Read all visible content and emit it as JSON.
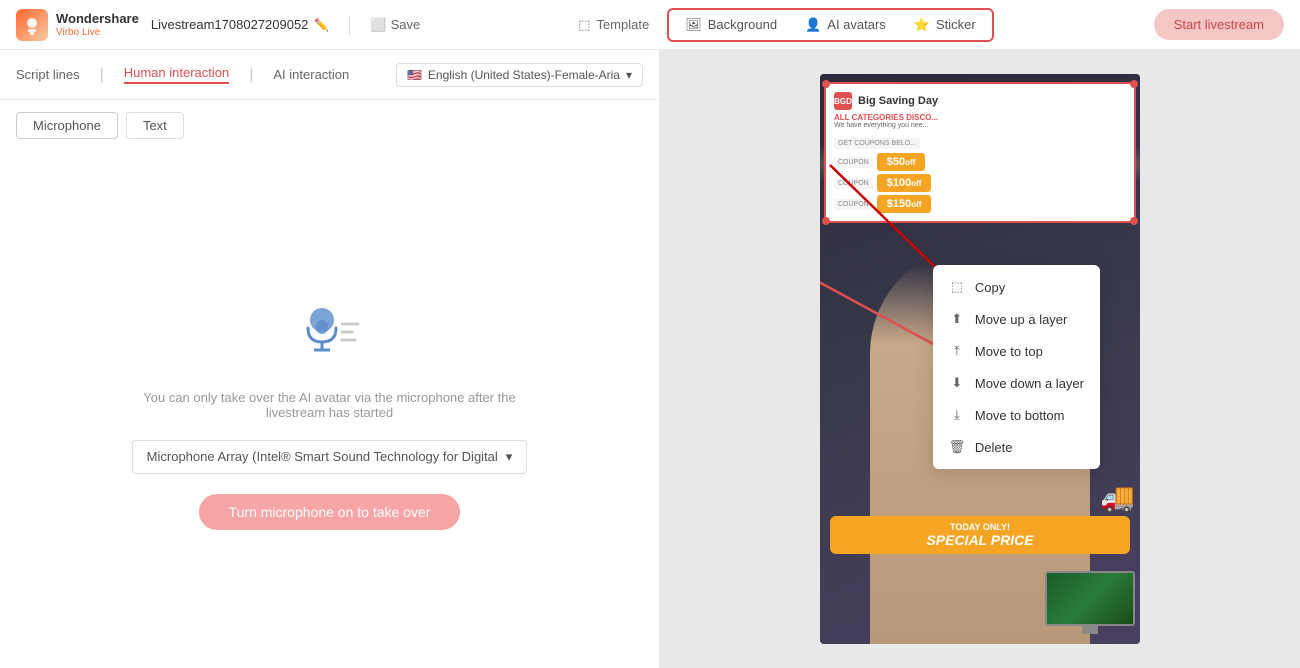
{
  "app": {
    "logo_line1": "Wondershare",
    "logo_line2": "Virbo Live",
    "stream_name": "Livestream1708027209052",
    "save_label": "Save",
    "template_label": "Template",
    "start_label": "Start livestream"
  },
  "header_tools": {
    "background_label": "Background",
    "ai_avatars_label": "AI avatars",
    "sticker_label": "Sticker"
  },
  "script": {
    "label": "Script lines",
    "tab_human": "Human interaction",
    "tab_ai": "AI interaction",
    "lang": "English (United States)-Female-Aria"
  },
  "sub_tabs": {
    "microphone_label": "Microphone",
    "text_label": "Text"
  },
  "mic_section": {
    "hint": "You can only take over the AI avatar via the microphone after the livestream has started",
    "device": "Microphone Array (Intel® Smart Sound Technology for Digital",
    "toggle_btn": "Turn microphone on to take over"
  },
  "context_menu": {
    "copy": "Copy",
    "move_up": "Move up a layer",
    "move_to_top": "Move to top",
    "move_down": "Move down a layer",
    "move_to_bottom": "Move to bottom",
    "delete": "Delete"
  },
  "sticker": {
    "logo_text": "BGD",
    "title": "Big Saving Day",
    "red_text": "ALL CATEGORIES DISCO...",
    "sub_text": "We have everything you nee...",
    "cta": "GET COUPONS BELO...",
    "coupons": [
      {
        "label": "COUPON",
        "amount": "$50",
        "suffix": "off"
      },
      {
        "label": "COUPON",
        "amount": "$100",
        "suffix": "off"
      },
      {
        "label": "COUPON",
        "amount": "$150",
        "suffix": "off"
      }
    ]
  },
  "special_price": {
    "today": "TODAY ONLY!",
    "text": "SPECIAL PRICE"
  },
  "colors": {
    "accent_red": "#e05050",
    "accent_orange": "#f5a523",
    "header_border": "#e8e8e8"
  }
}
